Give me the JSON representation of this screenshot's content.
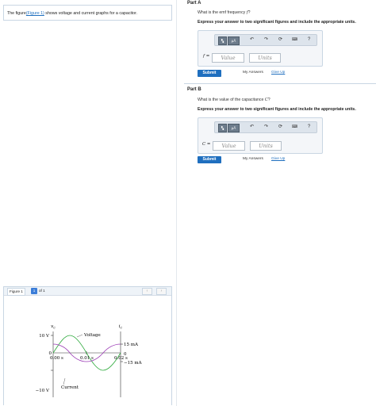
{
  "problem": {
    "prefix": "The figure",
    "link_text": "(Figure 1)",
    "suffix": " shows voltage and current graphs for a capacitor."
  },
  "figure_panel": {
    "label": "Figure 1",
    "current_page": "1",
    "of_text": "of 1",
    "prev_icon": "chevron-left",
    "next_icon": "chevron-right",
    "graph": {
      "axis_vc": "v",
      "axis_vc_sub": "C",
      "axis_ic": "i",
      "axis_ic_sub": "C",
      "voltage_label": "Voltage",
      "current_label": "Current",
      "v_pos": "10 V",
      "v_zero": "0",
      "v_neg": "−10 V",
      "t0": "0.00 s",
      "t1": "0.01 s",
      "t2": "0.02 s",
      "i_pos": "15 mA",
      "i_zero": "0",
      "i_neg": "−15 mA",
      "colors": {
        "voltage": "#2eaa3c",
        "current": "#9b3bb5"
      }
    }
  },
  "parts": [
    {
      "title": "Part A",
      "question": "What is the emf frequency ",
      "question_var": "f",
      "question_end": "?",
      "instruction": "Express your answer to two significant figures and include the appropriate units.",
      "answer_label": "f =",
      "value_placeholder": "Value",
      "units_placeholder": "Units",
      "submit": "Submit",
      "my_answers": "My Answers",
      "give_up": "Give Up"
    },
    {
      "title": "Part B",
      "question": "What is the value of the capacitance ",
      "question_var": "C",
      "question_end": "?",
      "instruction": "Express your answer to two significant figures and include the appropriate units.",
      "answer_label": "C =",
      "value_placeholder": "Value",
      "units_placeholder": "Units",
      "submit": "Submit",
      "my_answers": "My Answers",
      "give_up": "Give Up"
    }
  ],
  "toolbar": {
    "mu": "μÅ",
    "help": "?",
    "icons": [
      "templates-icon",
      "units-icon",
      "undo-icon",
      "redo-icon",
      "reset-icon",
      "keyboard-icon",
      "help-icon"
    ]
  }
}
